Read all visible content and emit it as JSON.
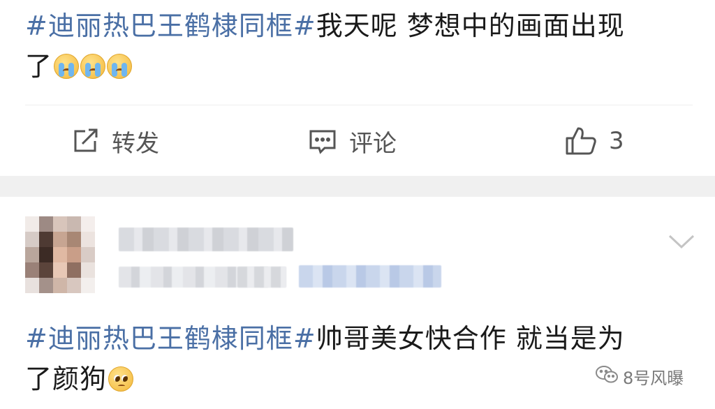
{
  "post1": {
    "hashtag": "#迪丽热巴王鹤棣同框#",
    "text_line1": "我天呢 梦想中的画面出现",
    "text_line2": "了",
    "emojis": [
      "crying-face",
      "crying-face",
      "crying-face"
    ]
  },
  "actions": {
    "repost_label": "转发",
    "comment_label": "评论",
    "like_count": "3"
  },
  "post2": {
    "hashtag": "#迪丽热巴王鹤棣同框#",
    "text_line1": "帅哥美女快合作 就当是为",
    "text_line2": "了颜狗",
    "emoji": "pleading-face"
  },
  "watermark": {
    "text": "8号风曝",
    "icon": "wechat-icon"
  },
  "colors": {
    "hashtag": "#4a6fa5",
    "text": "#1a1a1a",
    "action_gray": "#555555",
    "separator_band": "#f0f0f0"
  }
}
